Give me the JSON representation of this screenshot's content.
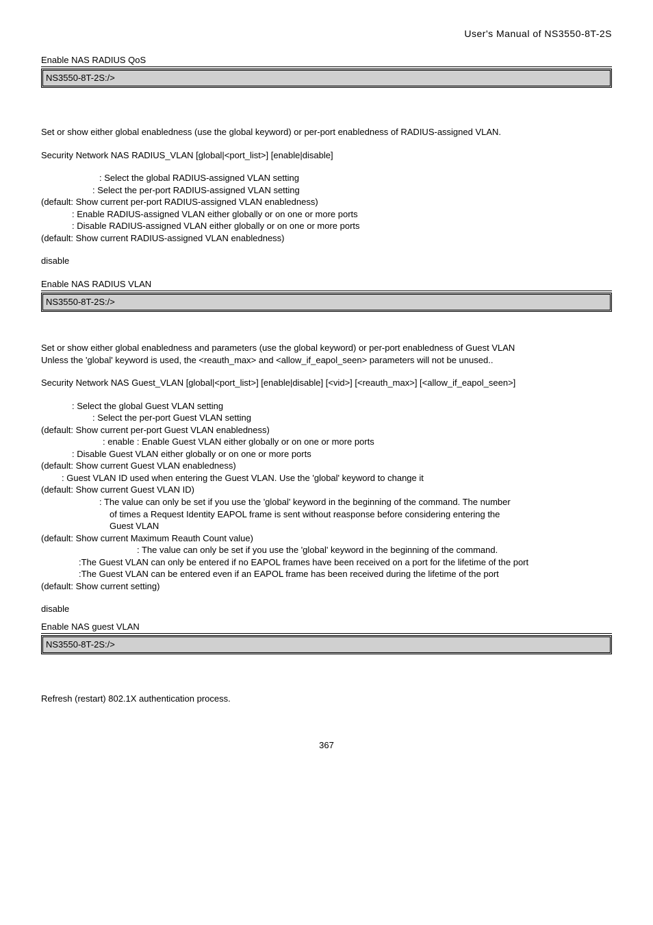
{
  "header": {
    "title": "User's  Manual  of  NS3550-8T-2S"
  },
  "s1": {
    "example_intro": "Enable NAS RADIUS QoS",
    "cmd": "NS3550-8T-2S:/>"
  },
  "s2": {
    "desc": "Set or show either global enabledness (use the global keyword) or per-port enabledness of RADIUS-assigned VLAN.",
    "syntax": "Security Network NAS RADIUS_VLAN [global|<port_list>] [enable|disable]",
    "p1": ": Select the global RADIUS-assigned VLAN setting",
    "p2": ": Select the per-port RADIUS-assigned VLAN setting",
    "p3": "(default: Show current per-port RADIUS-assigned VLAN enabledness)",
    "p4": ": Enable RADIUS-assigned VLAN either globally or on one or more ports",
    "p5": ": Disable RADIUS-assigned VLAN either globally or on one or more ports",
    "p6": "(default: Show current RADIUS-assigned VLAN enabledness)",
    "default": "disable",
    "example_intro": "Enable NAS RADIUS VLAN",
    "cmd": "NS3550-8T-2S:/>"
  },
  "s3": {
    "desc1": "Set or show either global enabledness and parameters (use the global keyword) or per-port enabledness of Guest VLAN",
    "desc2": "Unless the 'global' keyword is used, the <reauth_max> and <allow_if_eapol_seen> parameters will not be unused..",
    "syntax": "Security Network NAS Guest_VLAN [global|<port_list>] [enable|disable] [<vid>] [<reauth_max>] [<allow_if_eapol_seen>]",
    "p1": ": Select the global Guest VLAN setting",
    "p2": ": Select the per-port Guest VLAN setting",
    "p3": "(default: Show current per-port Guest VLAN enabledness)",
    "p4": ": enable : Enable Guest VLAN either globally or on one or more ports",
    "p5": ": Disable Guest VLAN either globally or on one or more ports",
    "p6": "(default: Show current Guest VLAN enabledness)",
    "p7": ": Guest VLAN ID used when entering the Guest VLAN. Use the 'global' keyword to change it",
    "p8": "(default: Show current Guest VLAN ID)",
    "p9a": ": The value can only be set if you use the 'global' keyword in the beginning of the command. The number",
    "p9b": "of times a Request Identity EAPOL frame is sent without reasponse before considering entering the",
    "p9c": "Guest VLAN",
    "p10": "(default: Show current Maximum Reauth Count value)",
    "p11a": ": The value can only be set if you use the 'global' keyword in the beginning of the command.",
    "p11b": ":The Guest VLAN can only be entered if no EAPOL frames have been received on a port for the lifetime of the port",
    "p11c": ":The Guest VLAN can be entered even if an EAPOL frame has been received during the lifetime of the port",
    "p12": "(default: Show current setting)",
    "default": "disable",
    "example_intro": "Enable NAS guest VLAN",
    "cmd": "NS3550-8T-2S:/>"
  },
  "s4": {
    "desc": "Refresh (restart) 802.1X authentication process."
  },
  "page": "367"
}
